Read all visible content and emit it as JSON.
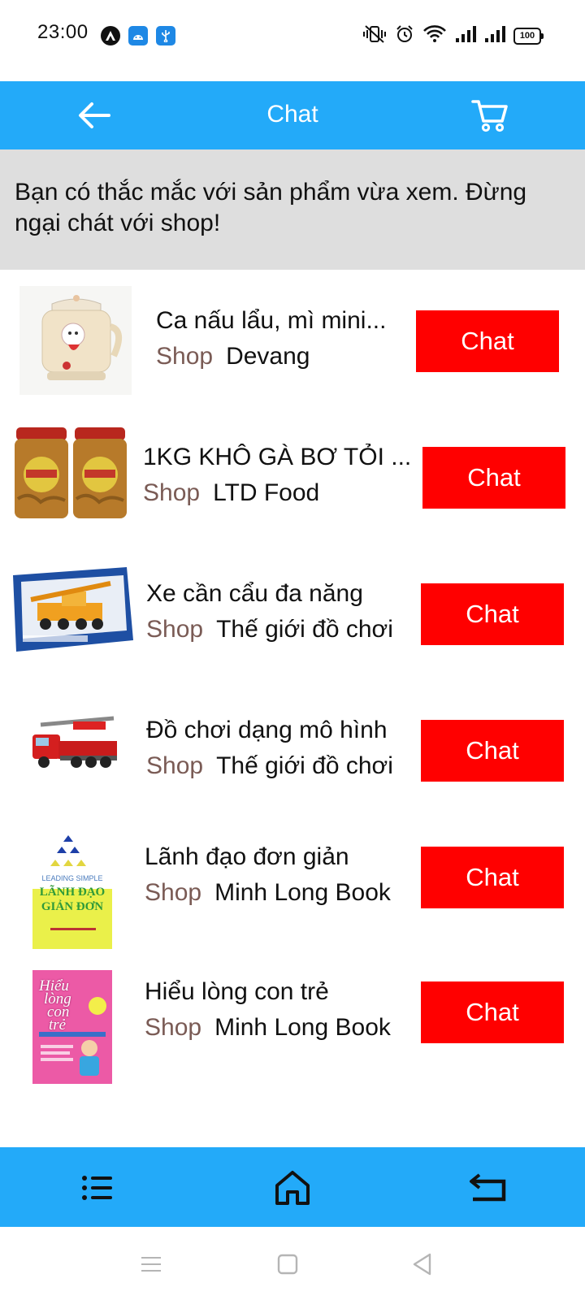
{
  "status_bar": {
    "time": "23:00",
    "battery": "100",
    "icons": [
      "app-a-icon",
      "android-icon",
      "usb-icon",
      "vibrate-icon",
      "alarm-icon",
      "wifi-icon",
      "signal-icon",
      "signal-icon",
      "battery-icon"
    ]
  },
  "app_bar": {
    "title": "Chat",
    "back_icon": "arrow-left-icon",
    "cart_icon": "cart-icon"
  },
  "banner": {
    "text": "Bạn có thắc mắc với sản phẩm vừa xem. Đừng ngại chát với shop!"
  },
  "products": [
    {
      "name": "Ca nấu lẩu, mì mini...",
      "shop_label": "Shop",
      "shop_name": "Devang",
      "chat_label": "Chat"
    },
    {
      "name": "1KG KHÔ GÀ BƠ TỎI ...",
      "shop_label": "Shop",
      "shop_name": "LTD Food",
      "chat_label": "Chat"
    },
    {
      "name": "Xe cần cẩu đa năng",
      "shop_label": "Shop",
      "shop_name": "Thế giới đồ chơi",
      "chat_label": "Chat"
    },
    {
      "name": "Đồ chơi dạng mô hình",
      "shop_label": "Shop",
      "shop_name": "Thế giới đồ chơi",
      "chat_label": "Chat"
    },
    {
      "name": "Lãnh đạo đơn giản",
      "shop_label": "Shop",
      "shop_name": "Minh Long Book",
      "chat_label": "Chat"
    },
    {
      "name": "Hiểu lòng con trẻ",
      "shop_label": "Shop",
      "shop_name": "Minh Long Book",
      "chat_label": "Chat"
    }
  ],
  "thumbnails": {
    "book1_lines": [
      "LEADING SIMPLE",
      "LÃNH ĐẠO",
      "GIẢN ĐƠN"
    ],
    "book2_lines": [
      "Hiểu",
      "lòng",
      "con",
      "trẻ"
    ]
  },
  "bottom_nav": {
    "items": [
      "list-icon",
      "home-icon",
      "return-icon"
    ]
  },
  "colors": {
    "primary": "#23aaf9",
    "chat_button": "#ff0000",
    "banner_bg": "#dedede",
    "shop_label": "#7a5b55"
  }
}
